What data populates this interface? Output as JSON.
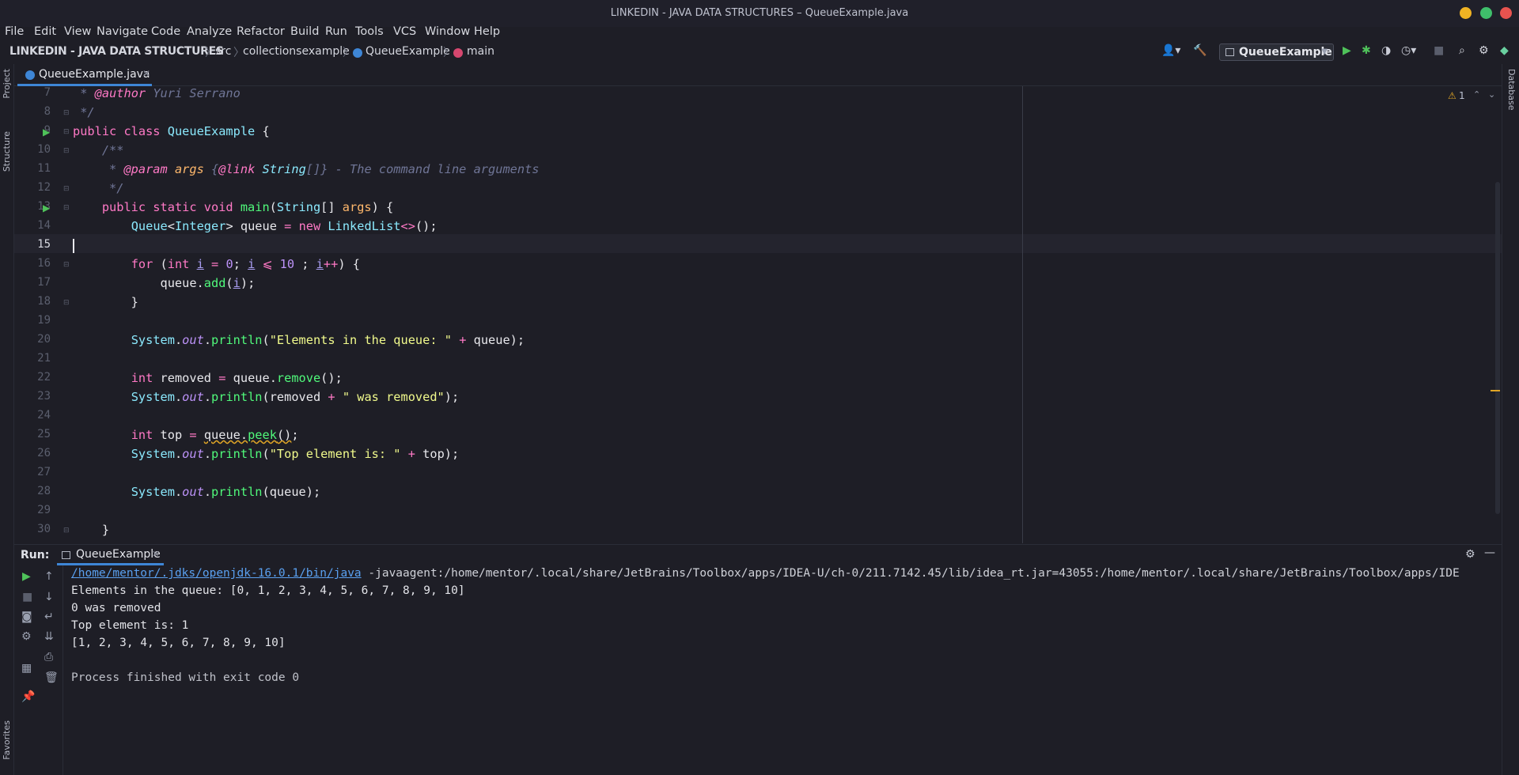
{
  "window": {
    "title": "LINKEDIN - JAVA DATA STRUCTURES – QueueExample.java"
  },
  "menu": [
    "File",
    "Edit",
    "View",
    "Navigate",
    "Code",
    "Analyze",
    "Refactor",
    "Build",
    "Run",
    "Tools",
    "VCS",
    "Window",
    "Help"
  ],
  "breadcrumb": {
    "project": "LINKEDIN - JAVA DATA STRUCTURES",
    "src": "src",
    "pkg": "collectionsexample",
    "cls": "QueueExample",
    "method": "main"
  },
  "toolbar": {
    "run_config": "QueueExample"
  },
  "tab": {
    "label": "QueueExample.java"
  },
  "side": {
    "project": "Project",
    "structure": "Structure",
    "favorites": "Favorites",
    "database": "Database"
  },
  "inspections": {
    "warnings": "1"
  },
  "line_numbers": [
    "7",
    "8",
    "9",
    "10",
    "11",
    "12",
    "13",
    "14",
    "15",
    "16",
    "17",
    "18",
    "19",
    "20",
    "21",
    "22",
    "23",
    "24",
    "25",
    "26",
    "27",
    "28",
    "29",
    "30"
  ],
  "run": {
    "label": "Run:",
    "tab": "QueueExample",
    "cmd_link": "/home/mentor/.jdks/openjdk-16.0.1/bin/java",
    "cmd_rest": " -javaagent:/home/mentor/.local/share/JetBrains/Toolbox/apps/IDEA-U/ch-0/211.7142.45/lib/idea_rt.jar=43055:/home/mentor/.local/share/JetBrains/Toolbox/apps/IDE",
    "output": [
      "Elements in the queue: [0, 1, 2, 3, 4, 5, 6, 7, 8, 9, 10]",
      "0 was removed",
      "Top element is: 1",
      "[1, 2, 3, 4, 5, 6, 7, 8, 9, 10]",
      "",
      "Process finished with exit code 0"
    ]
  },
  "colors": {
    "keyword": "#ff79c6",
    "class": "#8be9fd",
    "function": "#50fa7b",
    "string": "#f1fa8c",
    "number": "#bd93f9",
    "comment": "#6f7596",
    "accent": "#3e86d6"
  }
}
